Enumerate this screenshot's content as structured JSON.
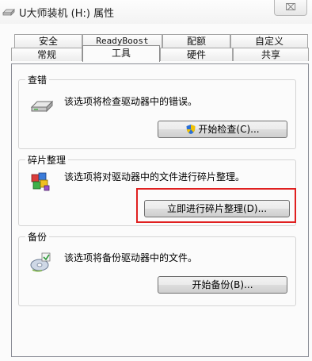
{
  "window": {
    "title": "U大师装机 (H:) 属性",
    "close_label": "⌧"
  },
  "tabs": {
    "row1": [
      "安全",
      "ReadyBoost",
      "配额",
      "自定义"
    ],
    "row2": [
      "常规",
      "工具",
      "硬件",
      "共享"
    ],
    "active": "工具"
  },
  "groups": {
    "check": {
      "label": "查错",
      "description": "该选项将检查驱动器中的错误。",
      "button": "开始检查(C)...",
      "icon": "drive-icon"
    },
    "defrag": {
      "label": "碎片整理",
      "description": "该选项将对驱动器中的文件进行碎片整理。",
      "button": "立即进行碎片整理(D)...",
      "icon": "defrag-icon"
    },
    "backup": {
      "label": "备份",
      "description": "该选项将备份驱动器中的文件。",
      "button": "开始备份(B)...",
      "icon": "backup-icon"
    }
  },
  "colors": {
    "highlight": "#e02020",
    "shield_blue": "#2a6fd6",
    "shield_yellow": "#f2c200"
  }
}
